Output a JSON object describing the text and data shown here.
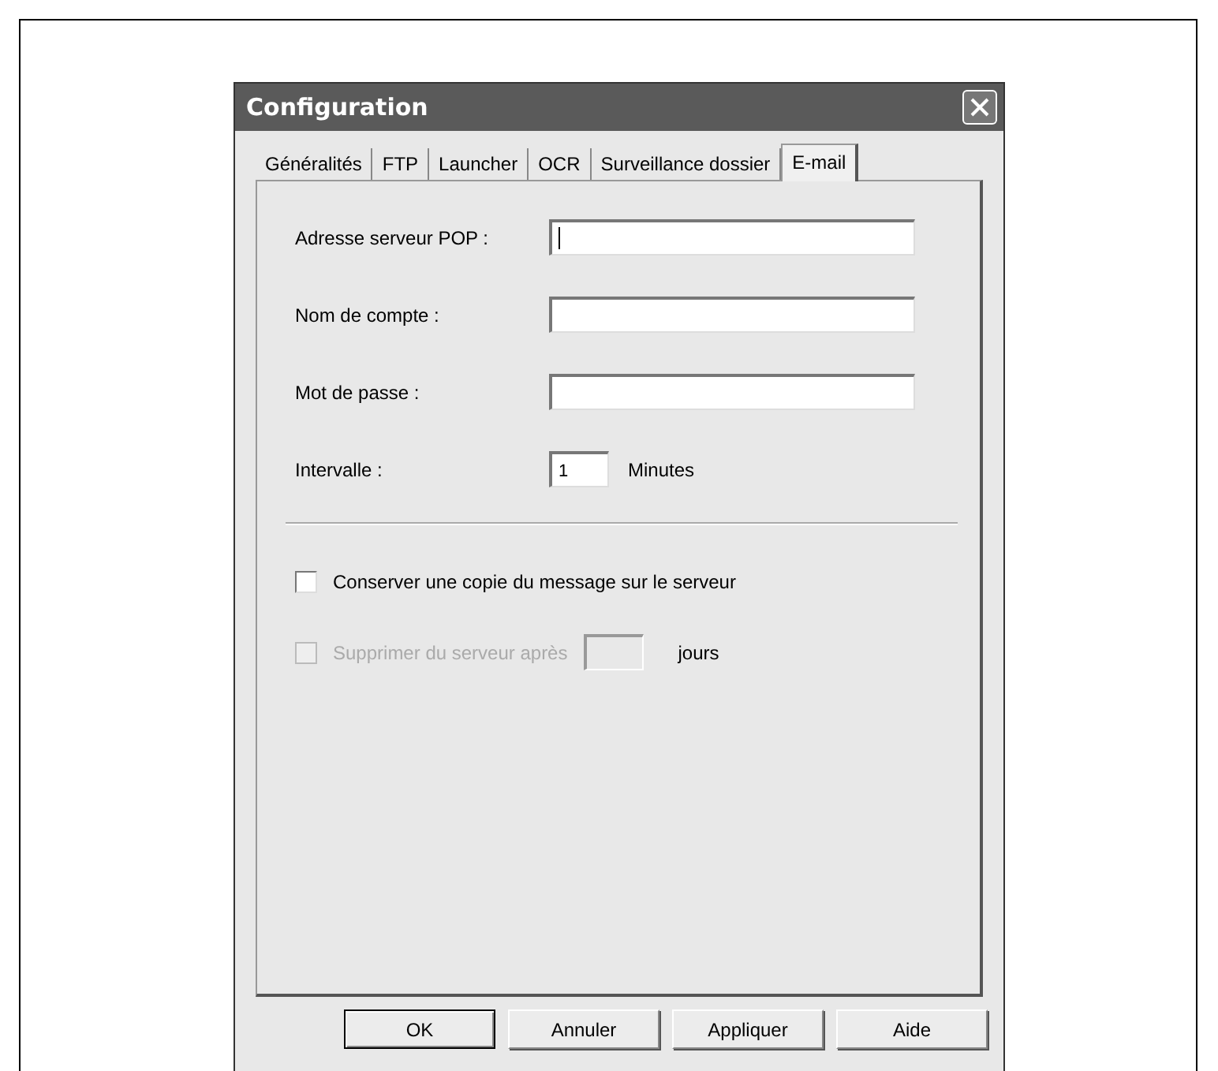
{
  "window": {
    "title": "Configuration"
  },
  "tabs": [
    {
      "label": "Généralités",
      "selected": false
    },
    {
      "label": "FTP",
      "selected": false
    },
    {
      "label": "Launcher",
      "selected": false
    },
    {
      "label": "OCR",
      "selected": false
    },
    {
      "label": "Surveillance dossier",
      "selected": false
    },
    {
      "label": "E-mail",
      "selected": true
    }
  ],
  "fields": [
    {
      "label": "Adresse serveur POP :",
      "focused": true,
      "kind": "wide"
    },
    {
      "label": "Nom de compte :",
      "focused": false,
      "kind": "wide"
    },
    {
      "label": "Mot de passe :",
      "focused": false,
      "kind": "wide"
    },
    {
      "label": "Intervalle :",
      "value": "1",
      "focused": false,
      "kind": "short",
      "unit": "Minutes"
    }
  ],
  "options": [
    {
      "label": "Conserver une copie du message sur le serveur",
      "checked": false,
      "disabled": false
    },
    {
      "label": "Supprimer du serveur après",
      "checked": false,
      "disabled": true,
      "unit": "jours"
    }
  ],
  "buttons": [
    {
      "label": "OK",
      "default": true
    },
    {
      "label": "Annuler",
      "default": false
    },
    {
      "label": "Appliquer",
      "default": false
    },
    {
      "label": "Aide",
      "default": false
    }
  ]
}
